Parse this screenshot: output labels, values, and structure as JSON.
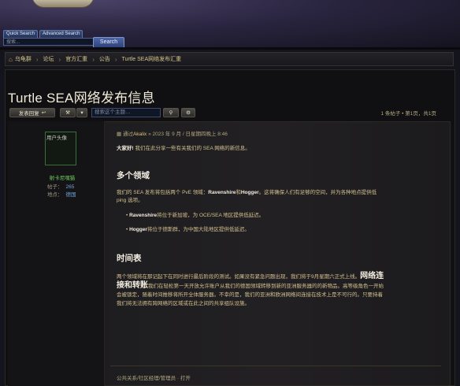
{
  "header": {
    "search_tabs": [
      "Quick Search",
      "Advanced Search"
    ],
    "search_placeholder": "搜索...",
    "search_button": "Search"
  },
  "breadcrumb": [
    "乌龟群",
    "论坛",
    "官方汇重",
    "公告",
    "Turtle SEA网络发布汇重"
  ],
  "page": {
    "title": "Turtle SEA网络发布信息",
    "reply_button": "发表回复",
    "search_topic_placeholder": "搜索这个主题…",
    "pager": "1 条帖子 • 第1页，共1页"
  },
  "post": {
    "avatar_alt": "用户头像",
    "username": "射卡尼嘿猫",
    "stats": [
      {
        "label": "帖子：",
        "value": "265"
      },
      {
        "label": "地点：",
        "value": "德国"
      }
    ],
    "meta_prefix": "通过",
    "author": "Akalix",
    "meta_date": "» 2023 年 9 月 / 日星期四晚上 8:46",
    "intro_bold": "大家好!",
    "intro_text": " 我们在此分享一些有关我们的 SEA 网络的新信息。",
    "section1_title": "多个领域",
    "section1_line1": "我们的 SEA 发布将包括两个 PvE 领域：",
    "section1_bold": "Ravenshire",
    "section1_line1b": "和",
    "section1_bold2": "Hogger",
    "section1_line1c": "。这将确保人们有足够的空间，并为各种地点提供低",
    "section1_line2": "ping 选项。",
    "bullet1_bold": "Ravenshire",
    "bullet1_text": "将位于新加坡，为 OCE/SEA 地区提供低延迟。",
    "bullet2_bold": "Hogger",
    "bullet2_text": "将位于德斯群，为中国大陆地区提供低延迟。",
    "section2_title": "时间表",
    "timeline_line1": "两个领域将在那记起下在同时进行最后阶段的测试。如果没有紧急问题出现，我们将于9月星期六正式上线。",
    "timeline_big1": "网络连",
    "timeline_big2": "接和转账",
    "timeline_line2": "我们在轻松第一天开放允许账户从我们的德国领域转移到新的亚洲服务器的的新物品。高等级角色一开始",
    "timeline_line3": "会被锁定，随着时间推移将所开全体服务器。不幸的是，我们的亚洲和欧洲网络间连接在技术上是不可行的。只要持着",
    "timeline_line4": "我们将无法拥有跨网络的区域或在此之间的共享组队设施。",
    "footer_link": "公共关系/社区经理/管理员 · 打开"
  }
}
